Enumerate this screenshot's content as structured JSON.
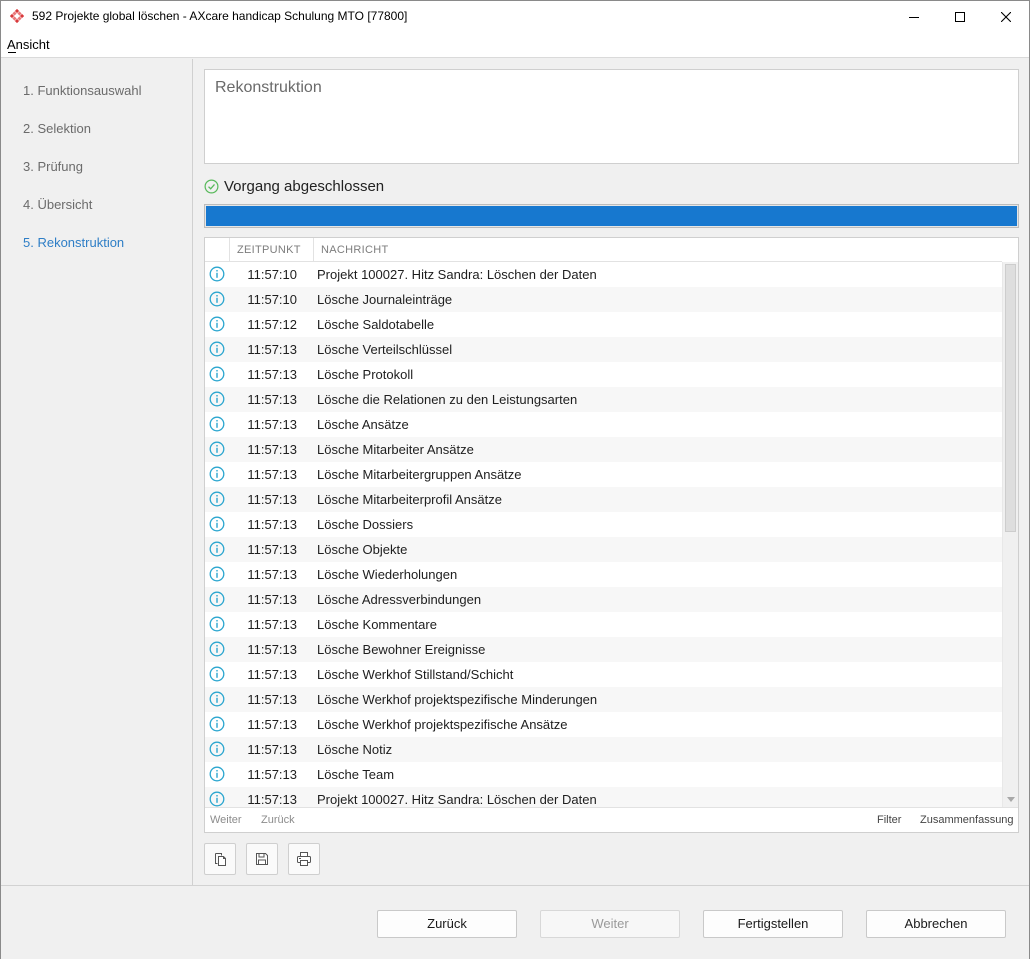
{
  "window": {
    "title": "592 Projekte global löschen - AXcare handicap Schulung MTO [77800]"
  },
  "menu": {
    "ansicht": "Ansicht"
  },
  "steps": [
    {
      "label": "1. Funktionsauswahl",
      "active": false
    },
    {
      "label": "2. Selektion",
      "active": false
    },
    {
      "label": "3. Prüfung",
      "active": false
    },
    {
      "label": "4. Übersicht",
      "active": false
    },
    {
      "label": "5. Rekonstruktion",
      "active": true
    }
  ],
  "panel": {
    "heading": "Rekonstruktion",
    "status_text": "Vorgang abgeschlossen",
    "progress_percent": 100
  },
  "log": {
    "columns": {
      "time": "ZEITPUNKT",
      "message": "NACHRICHT"
    },
    "rows": [
      {
        "time": "11:57:10",
        "message": "Projekt 100027. Hitz Sandra: Löschen der Daten"
      },
      {
        "time": "11:57:10",
        "message": "Lösche Journaleinträge"
      },
      {
        "time": "11:57:12",
        "message": "Lösche Saldotabelle"
      },
      {
        "time": "11:57:13",
        "message": "Lösche Verteilschlüssel"
      },
      {
        "time": "11:57:13",
        "message": "Lösche Protokoll"
      },
      {
        "time": "11:57:13",
        "message": "Lösche die Relationen zu den Leistungsarten"
      },
      {
        "time": "11:57:13",
        "message": "Lösche Ansätze"
      },
      {
        "time": "11:57:13",
        "message": "Lösche Mitarbeiter Ansätze"
      },
      {
        "time": "11:57:13",
        "message": "Lösche Mitarbeitergruppen Ansätze"
      },
      {
        "time": "11:57:13",
        "message": "Lösche Mitarbeiterprofil Ansätze"
      },
      {
        "time": "11:57:13",
        "message": "Lösche Dossiers"
      },
      {
        "time": "11:57:13",
        "message": "Lösche Objekte"
      },
      {
        "time": "11:57:13",
        "message": "Lösche Wiederholungen"
      },
      {
        "time": "11:57:13",
        "message": "Lösche Adressverbindungen"
      },
      {
        "time": "11:57:13",
        "message": "Lösche Kommentare"
      },
      {
        "time": "11:57:13",
        "message": "Lösche Bewohner Ereignisse"
      },
      {
        "time": "11:57:13",
        "message": "Lösche Werkhof Stillstand/Schicht"
      },
      {
        "time": "11:57:13",
        "message": "Lösche Werkhof projektspezifische Minderungen"
      },
      {
        "time": "11:57:13",
        "message": "Lösche Werkhof projektspezifische Ansätze"
      },
      {
        "time": "11:57:13",
        "message": "Lösche Notiz"
      },
      {
        "time": "11:57:13",
        "message": "Lösche Team"
      },
      {
        "time": "11:57:13",
        "message": "Projekt 100027. Hitz Sandra: Löschen der Daten"
      }
    ],
    "footer": {
      "next": "Weiter",
      "back": "Zurück",
      "filter": "Filter",
      "summary": "Zusammenfassung"
    }
  },
  "buttons": {
    "back": "Zurück",
    "next": "Weiter",
    "finish": "Fertigstellen",
    "cancel": "Abbrechen"
  },
  "icons": {
    "app": "app-logo-icon",
    "status": "check-circle-icon",
    "row": "info-icon",
    "copy": "copy-icon",
    "save": "save-icon",
    "print": "print-icon"
  },
  "colors": {
    "accent": "#1778cf",
    "active_step": "#2e7ec6",
    "status_ok": "#58b95b",
    "info_icon": "#2ba6cf"
  }
}
